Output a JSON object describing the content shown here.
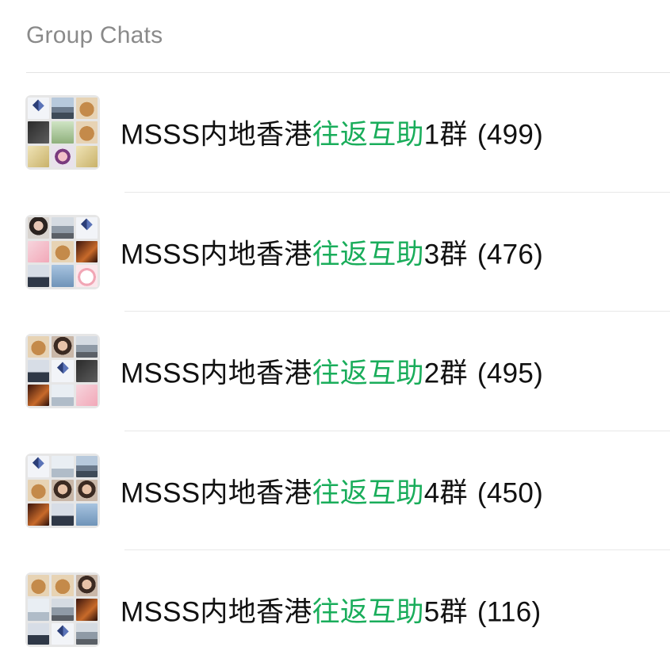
{
  "section": {
    "title": "Group Chats"
  },
  "colors": {
    "highlight": "#1aad5b",
    "text": "#111111",
    "header": "#8a8a8a"
  },
  "chats": [
    {
      "prefix": "MSSS内地香港",
      "highlight": "往返互助",
      "suffix": "1群",
      "count": "(499)",
      "avatar_tiles": [
        "logo",
        "city",
        "bear",
        "dark",
        "green",
        "bear",
        "yellow",
        "anime",
        "yellow"
      ]
    },
    {
      "prefix": "MSSS内地香港",
      "highlight": "往返互助",
      "suffix": "3群",
      "count": "(476)",
      "avatar_tiles": [
        "girl",
        "street",
        "logo",
        "pink",
        "bear",
        "fire",
        "person",
        "sky",
        "cat"
      ]
    },
    {
      "prefix": "MSSS内地香港",
      "highlight": "往返互助",
      "suffix": "2群",
      "count": "(495)",
      "avatar_tiles": [
        "bear",
        "portrait",
        "street",
        "person",
        "logo",
        "dark",
        "fire",
        "snow",
        "pink"
      ]
    },
    {
      "prefix": "MSSS内地香港",
      "highlight": "往返互助",
      "suffix": "4群",
      "count": "(450)",
      "avatar_tiles": [
        "logo",
        "snow",
        "city",
        "bear",
        "portrait",
        "portrait",
        "fire",
        "person",
        "sky"
      ]
    },
    {
      "prefix": "MSSS内地香港",
      "highlight": "往返互助",
      "suffix": "5群",
      "count": "(116)",
      "avatar_tiles": [
        "bear",
        "bear",
        "portrait",
        "snow",
        "street",
        "fire",
        "person",
        "logo",
        "street"
      ]
    }
  ]
}
